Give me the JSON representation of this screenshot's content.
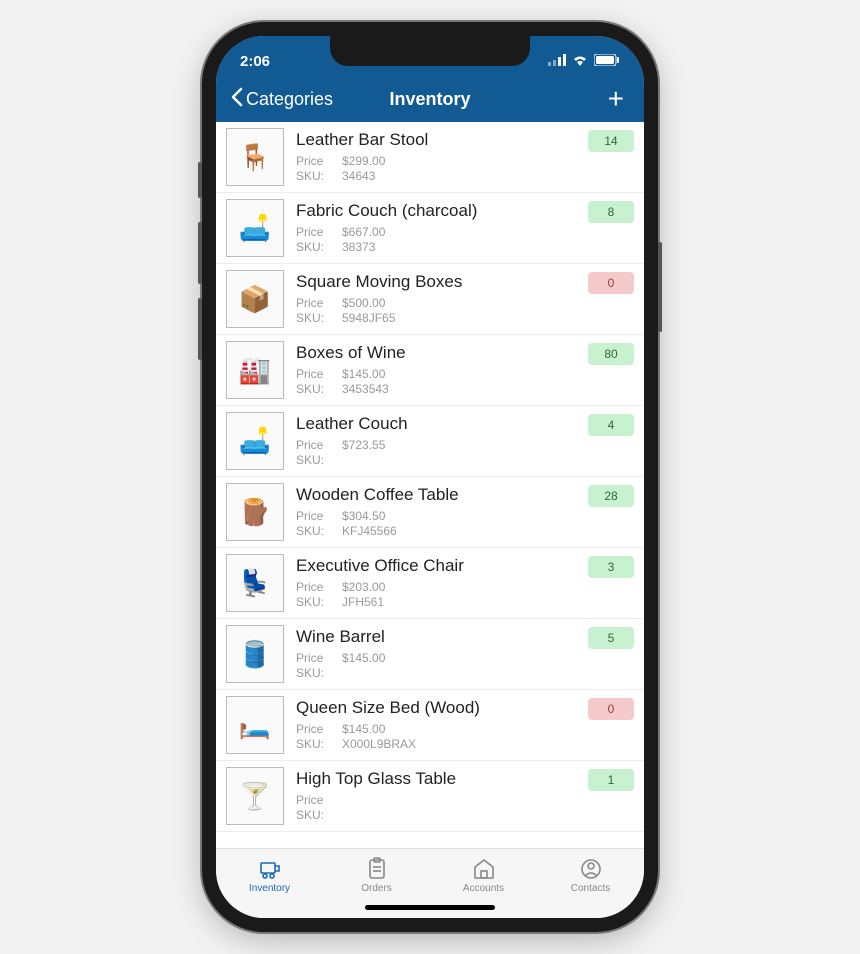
{
  "status": {
    "time": "2:06"
  },
  "nav": {
    "back_label": "Categories",
    "title": "Inventory",
    "add_label": "+"
  },
  "labels": {
    "price": "Price",
    "sku": "SKU:"
  },
  "items": [
    {
      "name": "Leather Bar Stool",
      "price": "$299.00",
      "sku": "34643",
      "qty": "14",
      "status": "green",
      "icon": "🪑"
    },
    {
      "name": "Fabric Couch (charcoal)",
      "price": "$667.00",
      "sku": "38373",
      "qty": "8",
      "status": "green",
      "icon": "🛋️"
    },
    {
      "name": "Square Moving Boxes",
      "price": "$500.00",
      "sku": "5948JF65",
      "qty": "0",
      "status": "red",
      "icon": "📦"
    },
    {
      "name": "Boxes of Wine",
      "price": "$145.00",
      "sku": "3453543",
      "qty": "80",
      "status": "green",
      "icon": "🏭"
    },
    {
      "name": "Leather Couch",
      "price": "$723.55",
      "sku": "",
      "qty": "4",
      "status": "green",
      "icon": "🛋️"
    },
    {
      "name": "Wooden Coffee Table",
      "price": "$304.50",
      "sku": "KFJ45566",
      "qty": "28",
      "status": "green",
      "icon": "🪵"
    },
    {
      "name": "Executive Office Chair",
      "price": "$203.00",
      "sku": "JFH561",
      "qty": "3",
      "status": "green",
      "icon": "💺"
    },
    {
      "name": "Wine Barrel",
      "price": "$145.00",
      "sku": "",
      "qty": "5",
      "status": "green",
      "icon": "🛢️"
    },
    {
      "name": "Queen Size Bed (Wood)",
      "price": "$145.00",
      "sku": "X000L9BRAX",
      "qty": "0",
      "status": "red",
      "icon": "🛏️"
    },
    {
      "name": "High Top Glass Table",
      "price": "",
      "sku": "",
      "qty": "1",
      "status": "green",
      "icon": "🍸"
    }
  ],
  "tabs": [
    {
      "id": "inventory",
      "label": "Inventory",
      "active": true
    },
    {
      "id": "orders",
      "label": "Orders",
      "active": false
    },
    {
      "id": "accounts",
      "label": "Accounts",
      "active": false
    },
    {
      "id": "contacts",
      "label": "Contacts",
      "active": false
    }
  ]
}
